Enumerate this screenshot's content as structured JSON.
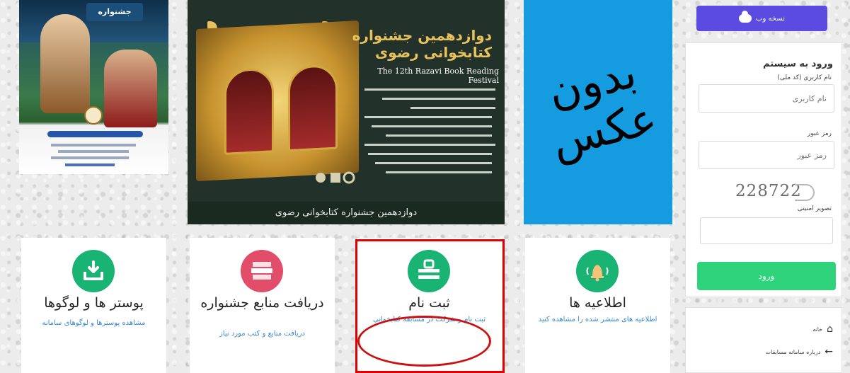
{
  "posters": {
    "sport_title": "جشنواره",
    "book_heading": "دوازدهمین جشنواره کتابخوانی رضوی",
    "book_subtitle": "The 12th Razavi Book Reading Festival",
    "book_footer": "دوازدهمین جشنواره کتابخوانی رضوی",
    "nophoto_text": "بدون عکس"
  },
  "sidebar": {
    "web_version_label": "نسخه وب",
    "login": {
      "title": "ورود به سیستم",
      "username_label": "نام کاربری (کد ملی)",
      "username_placeholder": "نام کاربری",
      "password_label": "رمز عبور",
      "password_placeholder": "رمز عبور",
      "captcha_text": "228722",
      "captcha_label": "تصویر امنیتی",
      "submit_label": "ورود"
    },
    "nav": [
      {
        "label": "خانه",
        "icon": "home-icon"
      },
      {
        "label": "درباره سامانه مسابقات",
        "icon": "arrow-left-icon"
      }
    ]
  },
  "cards": [
    {
      "title": "پوستر ها و لوگوها",
      "desc": "مشاهده پوسترها و لوگوهای سامانه",
      "icon": "download-tray-icon",
      "color": "#19b374"
    },
    {
      "title": "دریافت منابع جشنواره",
      "desc": "دریافت منابع و کتب مورد نیاز",
      "icon": "books-icon",
      "color": "#e24d6a"
    },
    {
      "title": "ثبت نام",
      "desc": "ثبت نام و شرکت در مسابقه کتابخوانی",
      "icon": "register-icon",
      "color": "#19b374"
    },
    {
      "title": "اطلاعیه ها",
      "desc": "اطلاعیه های منتشر شده را مشاهده کنید",
      "icon": "bell-icon",
      "color": "#19b374"
    }
  ],
  "colors": {
    "accent_green": "#19b374",
    "accent_red": "#e24d6a",
    "web_button": "#5b4be0",
    "login_button": "#2ed37c",
    "link_blue": "#3a8ad6",
    "annotation_red": "#e00000"
  }
}
